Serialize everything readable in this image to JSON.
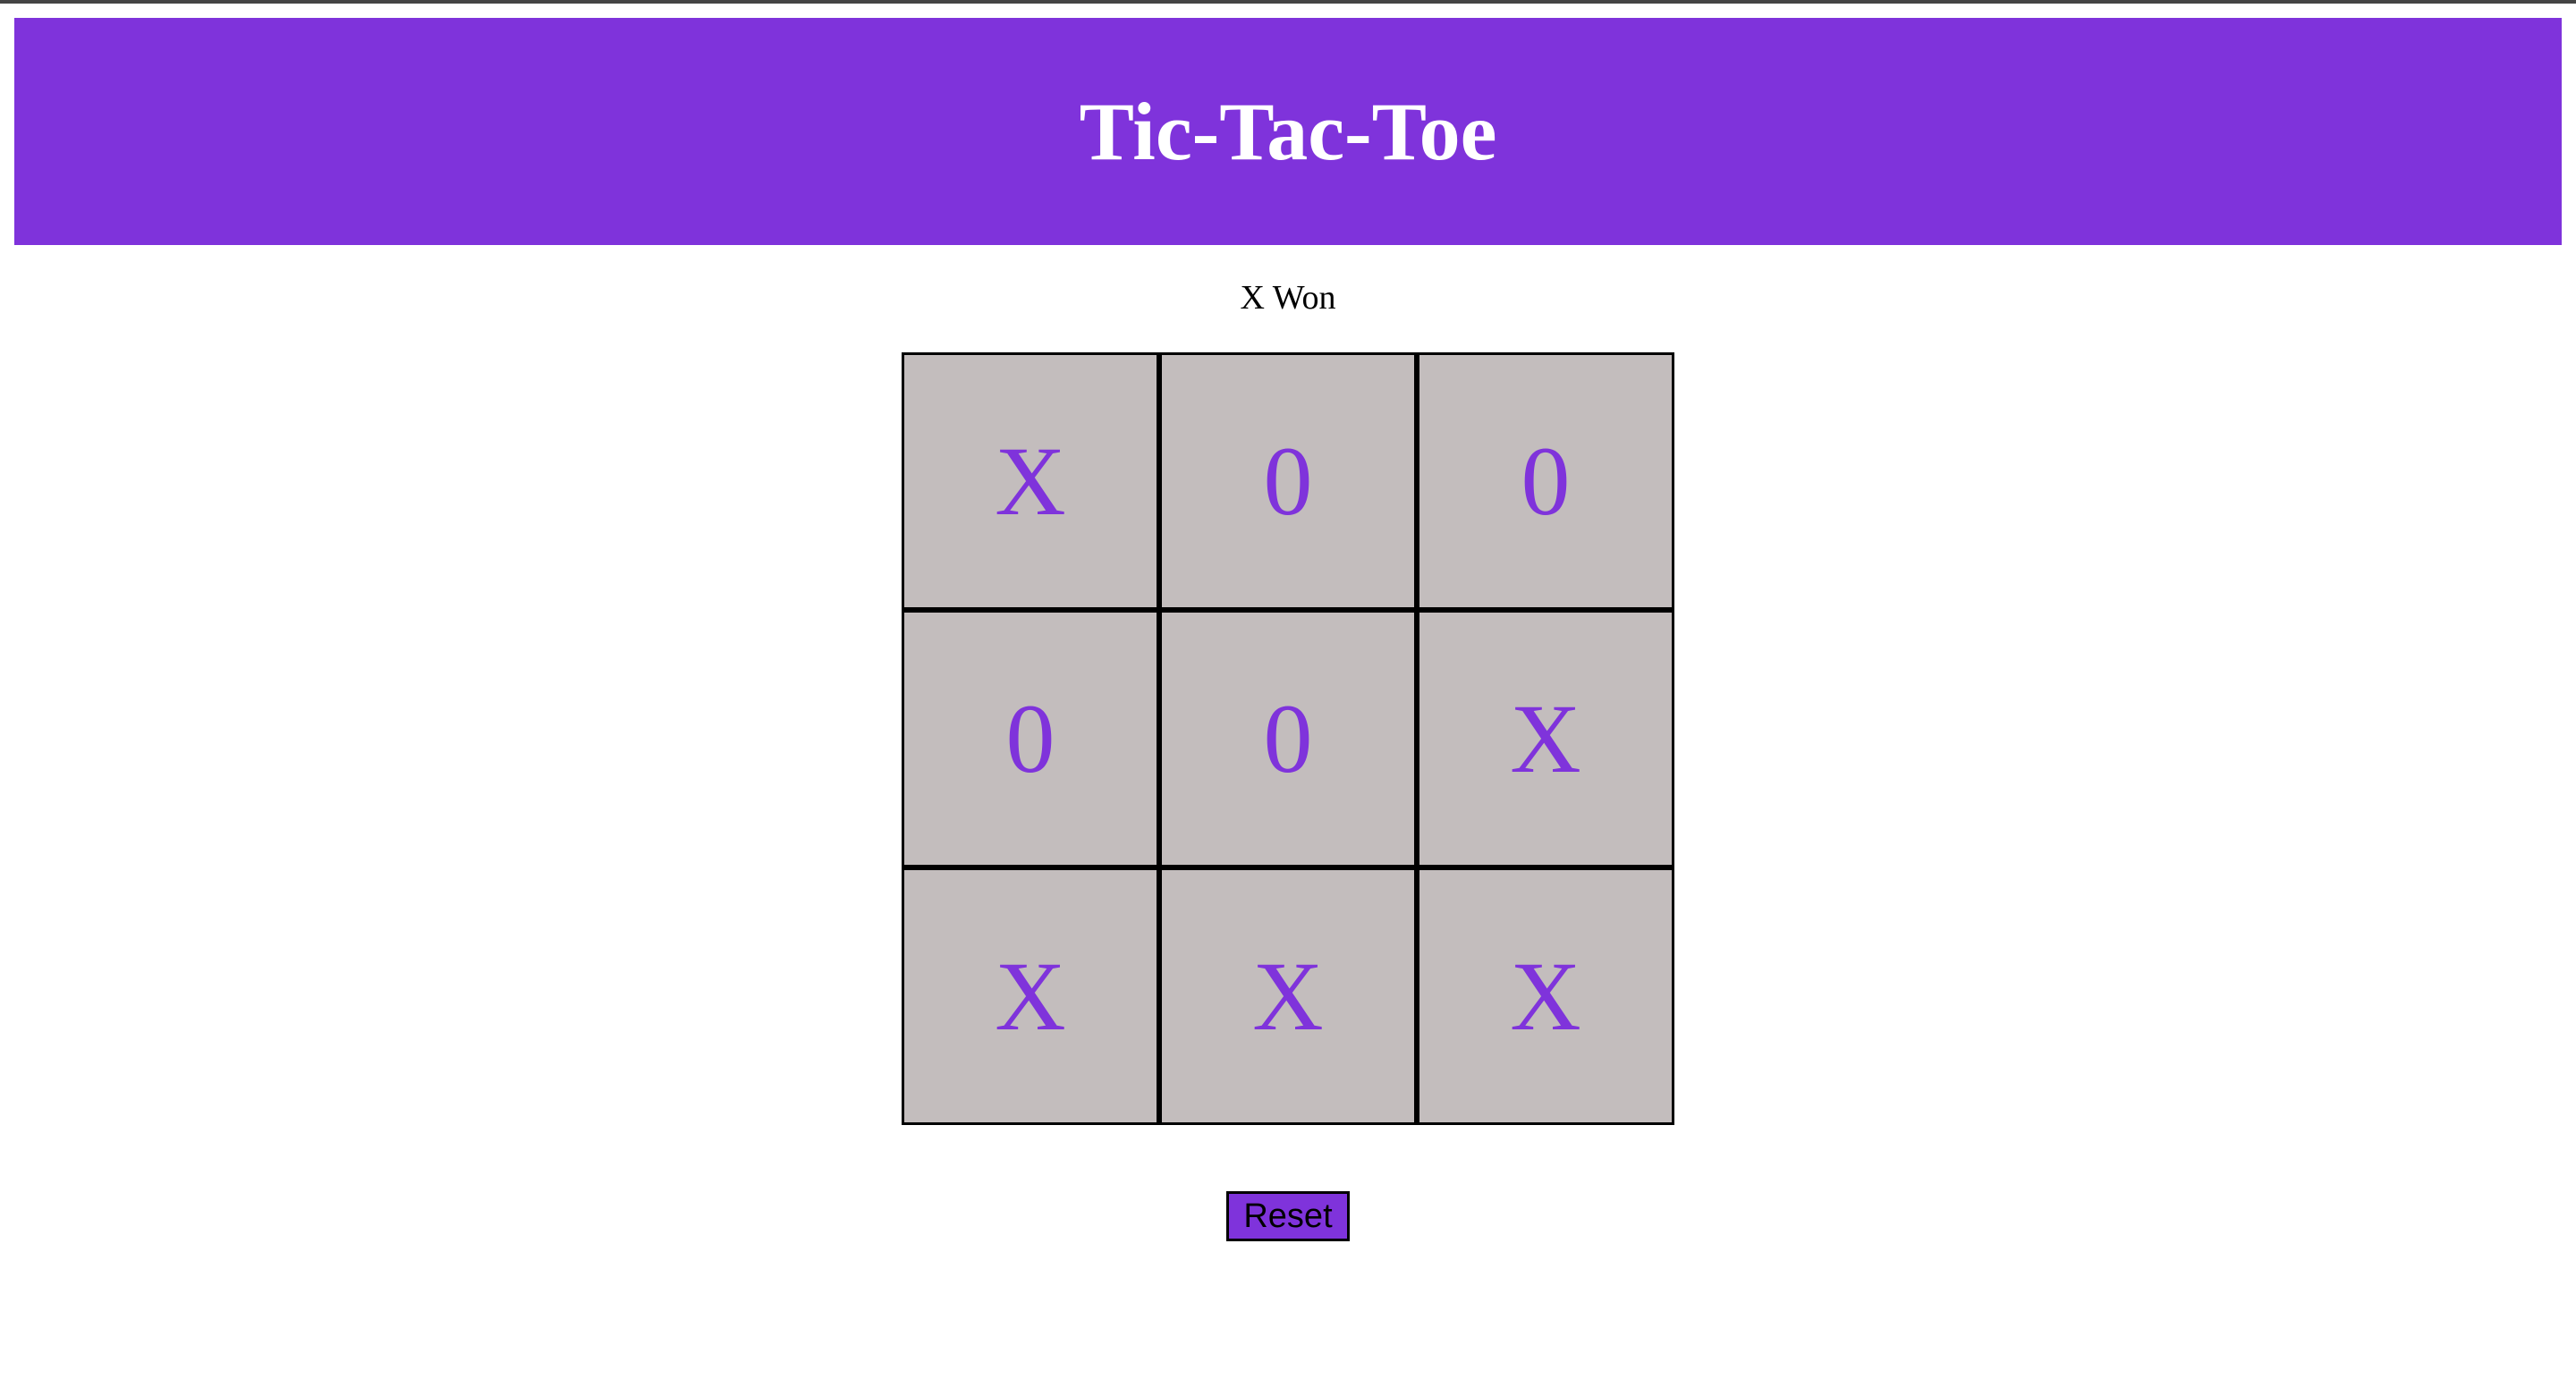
{
  "header": {
    "title": "Tic-Tac-Toe"
  },
  "status": {
    "text": "X Won"
  },
  "board": {
    "cells": [
      "X",
      "0",
      "0",
      "0",
      "0",
      "X",
      "X",
      "X",
      "X"
    ]
  },
  "controls": {
    "reset_label": "Reset"
  },
  "colors": {
    "accent": "#7f33db",
    "cell_background": "#c3bdbd",
    "cell_border": "#000000"
  }
}
